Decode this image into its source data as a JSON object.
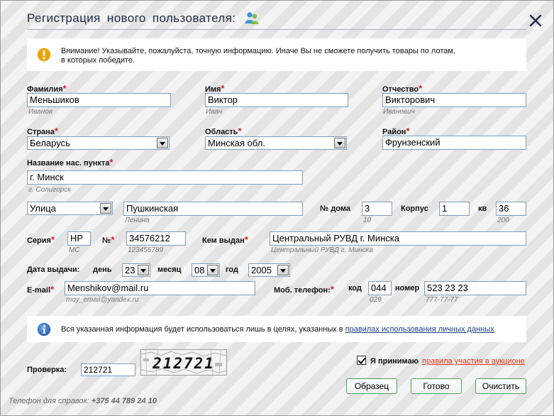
{
  "title": "Регистрация нового пользователя:",
  "notice": {
    "line1": "Внимание! Указывайте, пожалуйста, точную информацию. Иначе Вы не сможете получить товары по лотам,",
    "line2": "в которых победите."
  },
  "colors": {
    "accent": "#1f2a40",
    "required_star": "#d21e1e",
    "warning_icon": "#f0a000",
    "info_icon": "#2f6cc0",
    "button_border": "#4d9a4d",
    "input_border": "#7f9db9",
    "rules_link": "#e2331b"
  },
  "icons": {
    "title": "users-icon",
    "notice": "warning-icon",
    "info": "info-icon",
    "close": "close-icon"
  },
  "fields": {
    "surname": {
      "label": "Фамилия",
      "value": "Меньшиков",
      "hint": "Иванов"
    },
    "name": {
      "label": "Имя",
      "value": "Виктор",
      "hint": "Иван"
    },
    "patronymic": {
      "label": "Отчество",
      "value": "Викторович",
      "hint": "Иванович"
    },
    "country": {
      "label": "Страна",
      "value": "Беларусь"
    },
    "region": {
      "label": "Область",
      "value": "Минская обл."
    },
    "district": {
      "label": "Район",
      "value": "Фрунзенский"
    },
    "settlement": {
      "label": "Название нас. пункта",
      "value": "г. Минск",
      "hint": "г. Солигорск"
    },
    "street_type": {
      "value": "Улица"
    },
    "street": {
      "value": "Пушкинская",
      "hint": "Ленина"
    },
    "house": {
      "label": "№ дома",
      "value": "3",
      "hint": "10"
    },
    "building": {
      "label": "Корпус",
      "value": "1"
    },
    "apartment": {
      "label": "кв",
      "value": "36",
      "hint": "200"
    },
    "passport_series": {
      "label": "Серия",
      "value": "HP",
      "hint": "MC"
    },
    "passport_number": {
      "label": "№",
      "value": "34576212",
      "hint": "123456789"
    },
    "issued_by": {
      "label": "Кем выдан",
      "value": "Центральный РУВД г. Минска",
      "hint": "Центральный РУВД г. Минска"
    },
    "issue_date": {
      "label": "Дата выдачи:",
      "day_label": "день",
      "day": "23",
      "month_label": "месяц",
      "month": "08",
      "year_label": "год",
      "year": "2005"
    },
    "email": {
      "label": "E-mail",
      "value": "Menshikov@mail.ru",
      "hint": "moy_email@yandex.ru"
    },
    "mobile": {
      "label": "Моб. телефон:",
      "code_label": "код",
      "code": "044",
      "code_hint": "029",
      "number_label": "номер",
      "number": "523 23 23",
      "number_hint": "777-77-77"
    }
  },
  "info": {
    "text": "Вся указанная информация будет использоваться лишь в целях, указанных в",
    "link": "правилах использования личных данных"
  },
  "captcha": {
    "label": "Проверка:",
    "value": "212721",
    "image_text": "212721"
  },
  "agree": {
    "checked": true,
    "label": "Я принимаю",
    "link": "правила участия в аукционе"
  },
  "buttons": {
    "sample": "Образец",
    "done": "Готово",
    "clear": "Очистить"
  },
  "footer": {
    "label": "Телефон для справок:",
    "phone": "+375 44 789 24 10"
  }
}
